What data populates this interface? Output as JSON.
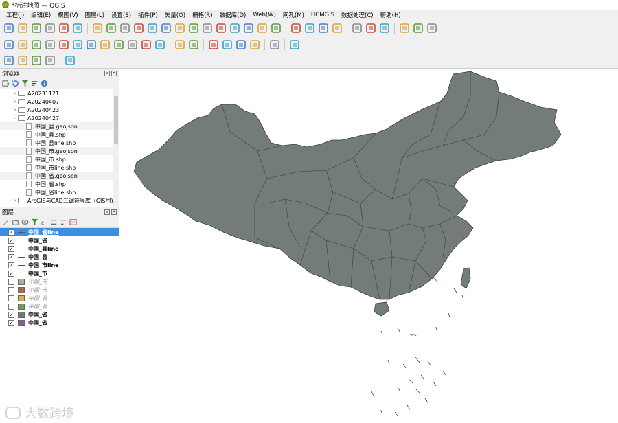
{
  "window": {
    "title": "*标注地图 — QGIS"
  },
  "menubar": [
    "工程(J)",
    "编辑(E)",
    "视图(V)",
    "图层(L)",
    "设置(S)",
    "插件(P)",
    "矢量(O)",
    "栅格(R)",
    "数据库(D)",
    "Web(W)",
    "网孔(M)",
    "HCMGIS",
    "数据处理(C)",
    "帮助(H)"
  ],
  "browser_panel": {
    "title": "浏览器",
    "items": [
      {
        "label": "A20231121",
        "kind": "folder",
        "caret": "›"
      },
      {
        "label": "A20240407",
        "kind": "folder",
        "caret": "›"
      },
      {
        "label": "A20240423",
        "kind": "folder",
        "caret": "›"
      },
      {
        "label": "A20240427",
        "kind": "folder",
        "caret": "⌄"
      },
      {
        "label": "中国_县.geojson",
        "kind": "file"
      },
      {
        "label": "中国_县.shp",
        "kind": "file"
      },
      {
        "label": "中国_县line.shp",
        "kind": "file"
      },
      {
        "label": "中国_市.geojson",
        "kind": "file"
      },
      {
        "label": "中国_市.shp",
        "kind": "file"
      },
      {
        "label": "中国_市line.shp",
        "kind": "file"
      },
      {
        "label": "中国_省.geojson",
        "kind": "file"
      },
      {
        "label": "中国_省.shp",
        "kind": "file"
      },
      {
        "label": "中国_省line.shp",
        "kind": "file"
      },
      {
        "label": "ArcGIS与CAD三调符号库（GIS用)",
        "kind": "folder",
        "caret": "›"
      }
    ]
  },
  "layers_panel": {
    "title": "图层",
    "items": [
      {
        "label": "中国_省line",
        "checked": true,
        "symbol": "line",
        "selected": true
      },
      {
        "label": "中国_省",
        "checked": true,
        "symbol": "none"
      },
      {
        "label": "中国_县line",
        "checked": true,
        "symbol": "line"
      },
      {
        "label": "中国_县",
        "checked": true,
        "symbol": "line"
      },
      {
        "label": "中国_市line",
        "checked": true,
        "symbol": "line"
      },
      {
        "label": "中国_市",
        "checked": true,
        "symbol": "none"
      },
      {
        "label": "中国_市",
        "checked": false,
        "symbol": "fill",
        "color": "#b7a997"
      },
      {
        "label": "中国_市",
        "checked": false,
        "symbol": "fill",
        "color": "#a06a48"
      },
      {
        "label": "中国_县",
        "checked": false,
        "symbol": "fill",
        "color": "#d9b148"
      },
      {
        "label": "中国_县",
        "checked": false,
        "symbol": "fill",
        "color": "#6f9a5f"
      },
      {
        "label": "中国_省",
        "checked": true,
        "symbol": "fill",
        "color": "#737b7b"
      },
      {
        "label": "中国_省",
        "checked": true,
        "symbol": "fill",
        "color": "#8e5a9a"
      }
    ]
  },
  "map": {
    "fill_color": "#737b7b",
    "stroke_color": "#3a3f3f",
    "background": "#ffffff"
  },
  "watermark": {
    "text": "大数跨境"
  },
  "colors": {
    "selection": "#3c8fe0",
    "toolbar_bg": "#f0f0f0"
  }
}
